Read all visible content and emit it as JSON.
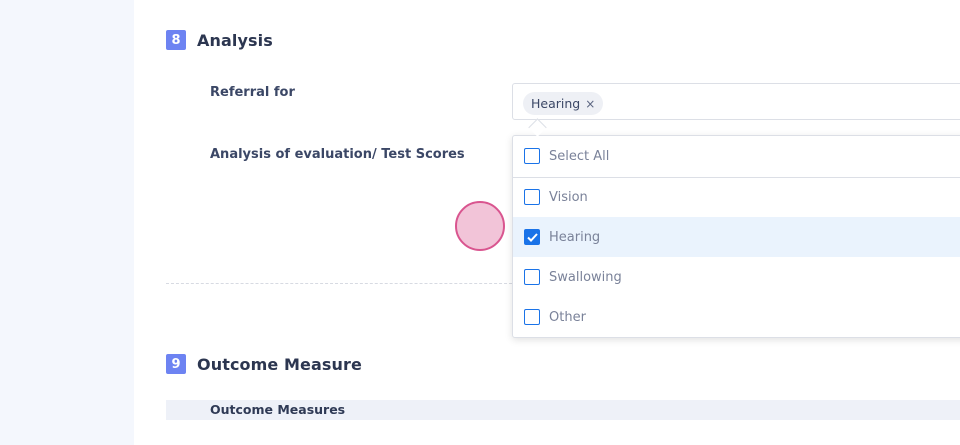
{
  "section8": {
    "number": "8",
    "title": "Analysis"
  },
  "fields": {
    "referral_label": "Referral for",
    "analysis_label": "Analysis of evaluation/ Test Scores"
  },
  "referral_select": {
    "chips": [
      "Hearing"
    ],
    "chip_remove_glyph": "×"
  },
  "dropdown": {
    "select_all_label": "Select All",
    "options": [
      {
        "label": "Vision",
        "checked": false
      },
      {
        "label": "Hearing",
        "checked": true
      },
      {
        "label": "Swallowing",
        "checked": false
      },
      {
        "label": "Other",
        "checked": false
      }
    ]
  },
  "section9": {
    "number": "9",
    "title": "Outcome Measure"
  },
  "outcome_table": {
    "header_label": "Outcome Measures"
  },
  "colors": {
    "accent": "#6d83f2",
    "checkbox_blue": "#1a73e8",
    "selected_row": "#eaf3fd",
    "cursor_fill": "#f2c4d8",
    "cursor_border": "#d9558f"
  }
}
